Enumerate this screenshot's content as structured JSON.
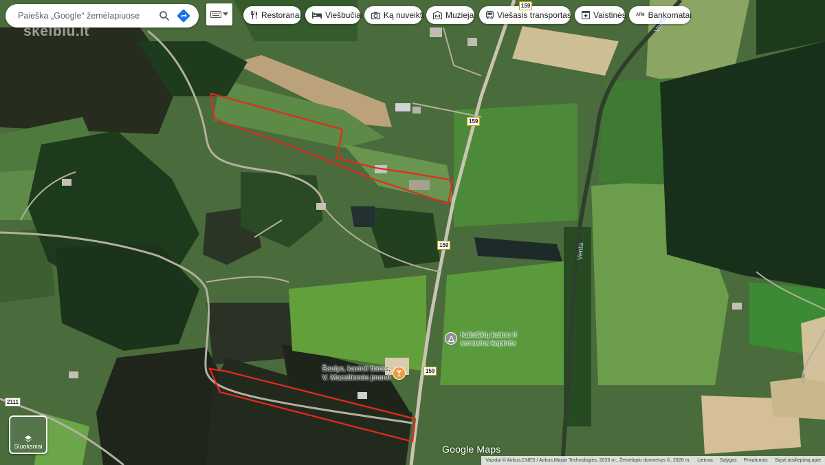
{
  "search": {
    "placeholder": "Paieška „Google“ žemėlapiuose"
  },
  "watermark": "skelbiu.lt",
  "categories": [
    {
      "label": "Restoranai",
      "icon": "fork-knife-icon"
    },
    {
      "label": "Viešbučiai",
      "icon": "bed-icon"
    },
    {
      "label": "Ką nuveikti",
      "icon": "camera-icon"
    },
    {
      "label": "Muziejai",
      "icon": "museum-icon"
    },
    {
      "label": "Viešasis transportas",
      "icon": "bus-icon"
    },
    {
      "label": "Vaistinės",
      "icon": "pharmacy-icon"
    },
    {
      "label": "Bankomatai",
      "icon": "atm-icon"
    }
  ],
  "atm_badge": "ATM",
  "places": {
    "cemetery": [
      "Kalniškių kaimo II",
      "senosios kapinės"
    ],
    "cafe": [
      "Šaulys, kavinė baras,",
      "V. Macaitienės įmonė"
    ]
  },
  "roads": {
    "r159_a": "159",
    "r159_b": "159",
    "r159_c": "159",
    "r159_d": "159",
    "r2111": "2111"
  },
  "rivers": {
    "venta_a": "Venta",
    "venta_b": "Venta"
  },
  "layers_label": "Sluoksniai",
  "logo": "Google Maps",
  "footer": {
    "attribution": "Vaizdai © Airbus,CNES / Airbus,Maxar Technologies, 2026 m., Žemėlapio duomenys ©, 2026 m.",
    "country": "Lietuva",
    "terms": "Sąlygos",
    "privacy": "Privatumas",
    "feedback": "Siųsti atsiliepimą apie"
  },
  "colors": {
    "parcel_outline": "#e8281e",
    "cafe_pin": "#f29a3c",
    "cemetery_pin": "#8a8f94"
  }
}
